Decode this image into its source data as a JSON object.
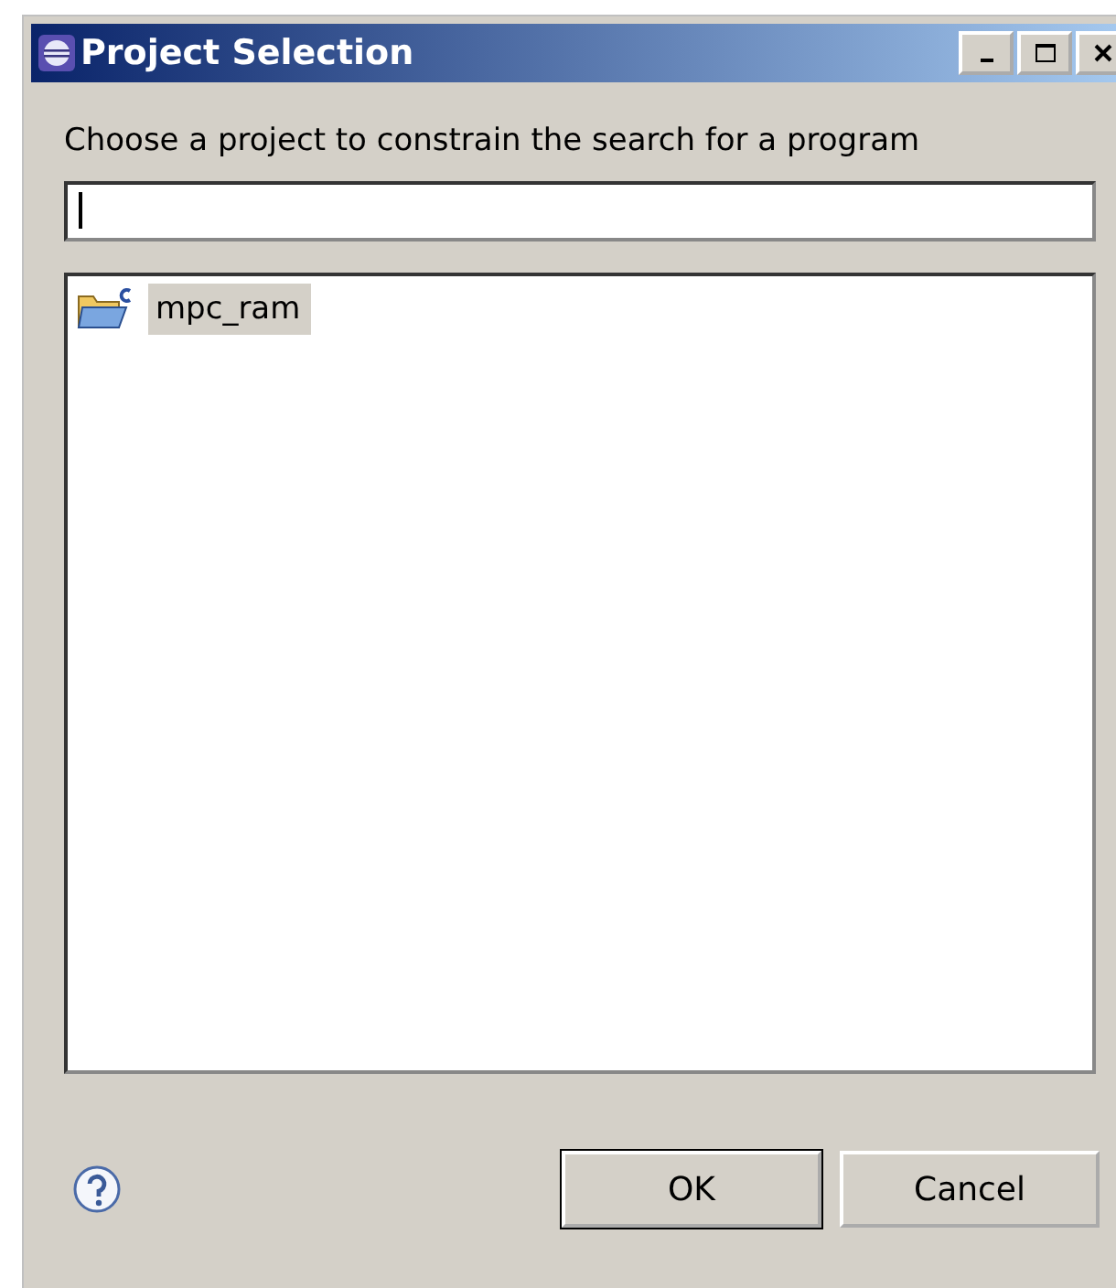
{
  "window": {
    "title": "Project Selection"
  },
  "prompt": "Choose a project to constrain the search for a program",
  "projects": [
    {
      "name": "mpc_ram",
      "selected": true
    }
  ],
  "buttons": [
    {
      "label": "OK",
      "default": true
    },
    {
      "label": "Cancel",
      "default": false
    }
  ]
}
